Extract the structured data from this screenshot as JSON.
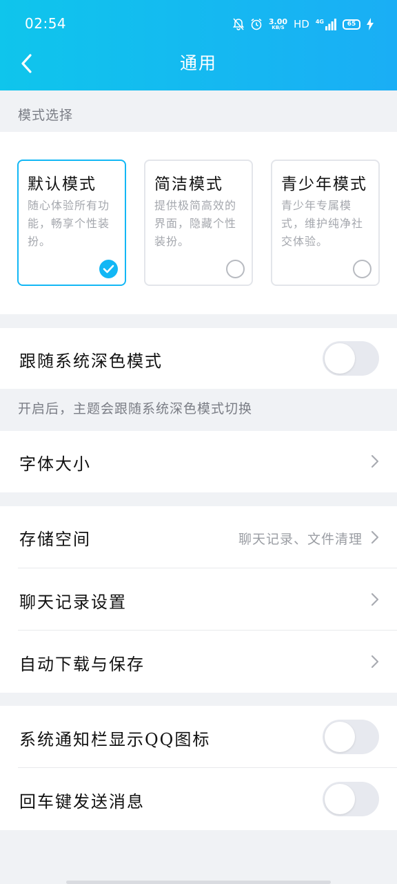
{
  "status_bar": {
    "time": "02:54",
    "net_speed_value": "3.00",
    "net_speed_unit": "KB/S",
    "hd": "HD",
    "network_type": "4G",
    "battery": "65"
  },
  "header": {
    "title": "通用",
    "back_icon": "chevron-left-icon"
  },
  "mode_section": {
    "label": "模式选择",
    "modes": [
      {
        "title": "默认模式",
        "desc": "随心体验所有功能，畅享个性装扮。",
        "selected": true
      },
      {
        "title": "简洁模式",
        "desc": "提供极简高效的界面，隐藏个性装扮。",
        "selected": false
      },
      {
        "title": "青少年模式",
        "desc": "青少年专属模式，维护纯净社交体验。",
        "selected": false
      }
    ]
  },
  "dark_mode": {
    "label": "跟随系统深色模式",
    "enabled": false,
    "hint": "开启后，主题会跟随系统深色模式切换"
  },
  "font_size": {
    "label": "字体大小"
  },
  "storage_group": {
    "storage": {
      "label": "存储空间",
      "value": "聊天记录、文件清理"
    },
    "chat_history": {
      "label": "聊天记录设置"
    },
    "auto_download": {
      "label": "自动下载与保存"
    }
  },
  "notification_group": {
    "show_qq_icon": {
      "label": "系统通知栏显示QQ图标",
      "enabled": false
    },
    "enter_to_send": {
      "label": "回车键发送消息",
      "enabled": false
    }
  },
  "colors": {
    "header_gradient_start": "#0fc5ec",
    "header_gradient_end": "#1aaef5",
    "accent": "#12b7f5",
    "background": "#f0f2f5"
  }
}
